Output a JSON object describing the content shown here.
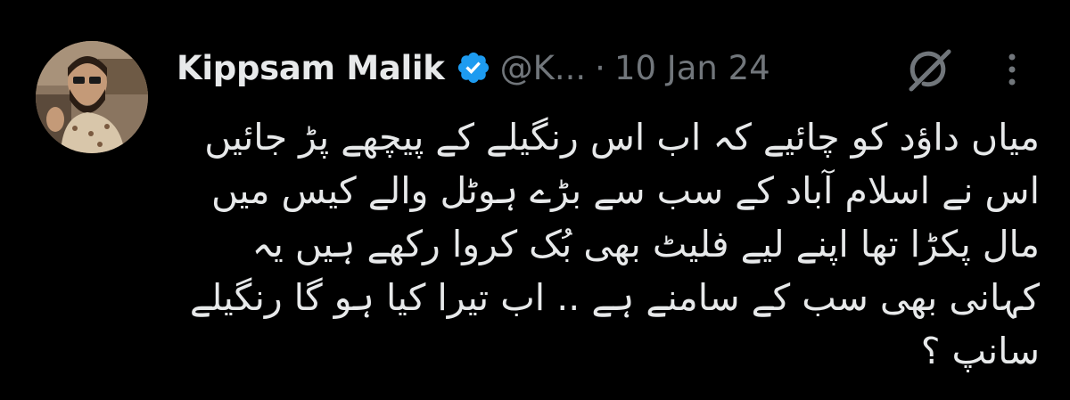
{
  "tweet": {
    "author": {
      "display_name": "Kippsam Malik",
      "handle": "@K...",
      "verified": true,
      "avatar_icon": "profile-photo"
    },
    "separator": "·",
    "date": "10 Jan 24",
    "text_lines": [
      "میاں داؤد کو چائیے کہ اب اس رنگیلے کے پیچھے پڑ جائیں",
      "اس نے اسلام آباد کے سب سے بڑے ہوٹل والے کیس میں",
      "مال پکڑا تھا اپنے لیے فلیٹ بھی بُک کروا رکھے ہیں یہ",
      "کہانی بھی سب کے سامنے ہے .. اب تیرا کیا ہو گا رنگیلے",
      "سانپ ؟"
    ],
    "icons": {
      "verified": "verified-badge-icon",
      "grok": "grok-icon",
      "more": "more-options-icon"
    }
  },
  "colors": {
    "background": "#000000",
    "primary_text": "#e7e9ea",
    "secondary_text": "#71767b",
    "verified_blue": "#1d9bf0"
  }
}
